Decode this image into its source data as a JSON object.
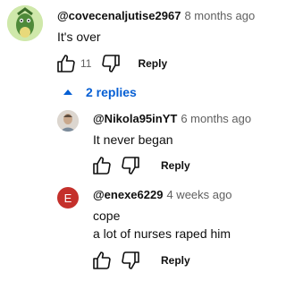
{
  "comment": {
    "author": "@covecenaljutise2967",
    "time": "8 months ago",
    "text": "It's over",
    "likes": "11",
    "reply_label": "Reply"
  },
  "replies_toggle": {
    "label": "2 replies",
    "icon": "chevron-up-icon"
  },
  "replies": [
    {
      "author": "@Nikola95inYT",
      "time": "6 months ago",
      "lines": [
        "It never began"
      ],
      "reply_label": "Reply"
    },
    {
      "author": "@enexe6229",
      "time": "4 weeks ago",
      "avatar_letter": "E",
      "lines": [
        "cope",
        "a lot of nurses raped him"
      ],
      "reply_label": "Reply"
    }
  ],
  "colors": {
    "link_blue": "#065fd4",
    "letter_avatar_bg": "#c4302b"
  }
}
